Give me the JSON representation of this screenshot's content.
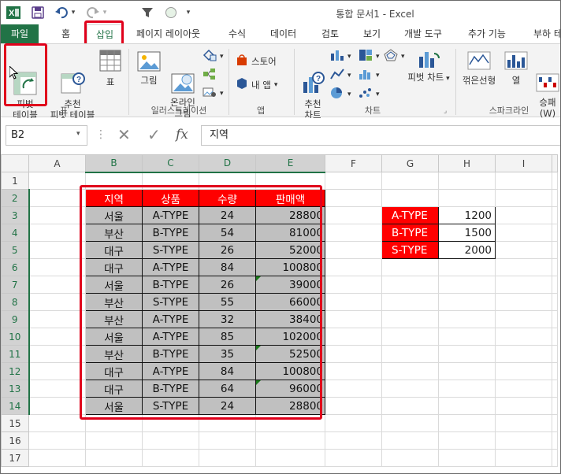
{
  "quick_access": {
    "excel_icon": "excel-logo-icon",
    "undo_arrow": "▾",
    "customize_arrow": "▾"
  },
  "title": "통합 문서1 - Excel",
  "tabs": {
    "file": "파일",
    "items": [
      "홈",
      "삽입",
      "페이지 레이아웃",
      "수식",
      "데이터",
      "검토",
      "보기",
      "개발 도구",
      "추가 기능",
      "부하 테"
    ]
  },
  "ribbon": {
    "pivot_table": "피벗\n테이블",
    "recommended_pivot": "추천\n피벗 테이블",
    "table": "표",
    "group_table": "표",
    "picture": "그림",
    "online_picture": "온라인\n그림",
    "group_illustrations": "일러스트레이션",
    "store": "스토어",
    "my_apps": "내 앱",
    "group_apps": "앱",
    "recommended_charts": "추천\n차트",
    "pivot_chart": "피벗 차트",
    "group_charts": "차트",
    "line_sparkline": "꺾은선형",
    "column_sparkline": "열",
    "winloss_sparkline": "승패\n(W)",
    "group_sparklines": "스파크라인"
  },
  "formula_bar": {
    "name_box": "B2",
    "fx": "fx",
    "content": "지역"
  },
  "grid": {
    "columns": [
      "A",
      "B",
      "C",
      "D",
      "E",
      "F",
      "G",
      "H",
      "I"
    ],
    "rows": [
      "1",
      "2",
      "3",
      "4",
      "5",
      "6",
      "7",
      "8",
      "9",
      "10",
      "11",
      "12",
      "13",
      "14",
      "15",
      "16",
      "17"
    ],
    "headers": [
      "지역",
      "상품",
      "수량",
      "판매액"
    ],
    "data": [
      [
        "서울",
        "A-TYPE",
        "24",
        "28800"
      ],
      [
        "부산",
        "B-TYPE",
        "54",
        "81000"
      ],
      [
        "대구",
        "S-TYPE",
        "26",
        "52000"
      ],
      [
        "대구",
        "A-TYPE",
        "84",
        "100800"
      ],
      [
        "서울",
        "B-TYPE",
        "26",
        "39000"
      ],
      [
        "부산",
        "S-TYPE",
        "55",
        "66000"
      ],
      [
        "부산",
        "A-TYPE",
        "32",
        "38400"
      ],
      [
        "서울",
        "A-TYPE",
        "85",
        "102000"
      ],
      [
        "부산",
        "B-TYPE",
        "35",
        "52500"
      ],
      [
        "대구",
        "A-TYPE",
        "84",
        "100800"
      ],
      [
        "대구",
        "B-TYPE",
        "64",
        "96000"
      ],
      [
        "서울",
        "S-TYPE",
        "24",
        "28800"
      ]
    ],
    "price_table": [
      [
        "A-TYPE",
        "1200"
      ],
      [
        "B-TYPE",
        "1500"
      ],
      [
        "S-TYPE",
        "2000"
      ]
    ]
  },
  "colors": {
    "excel_green": "#217346",
    "highlight_red": "#e0001b",
    "header_red": "#ff0000",
    "data_gray": "#c0c0c0"
  }
}
